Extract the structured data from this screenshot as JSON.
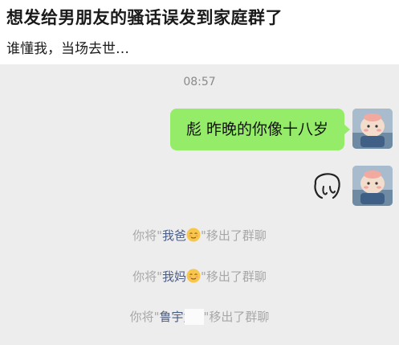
{
  "post": {
    "title": "想发给男朋友的骚话误发到家庭群了",
    "subtitle": "谁懂我，当场去世…"
  },
  "chat": {
    "timestamp": "08:57",
    "message": "彪 昨晚的你像十八岁",
    "system_messages": [
      {
        "prefix": "你将\"",
        "name": "我爸",
        "emoji": "relieved-face-icon",
        "suffix": "\"移出了群聊"
      },
      {
        "prefix": "你将\"",
        "name": "我妈",
        "emoji": "relieved-face-icon",
        "suffix": "\"移出了群聊"
      },
      {
        "prefix": "你将\"",
        "name": "鲁宇竟",
        "suffix": "\"移出了群聊"
      }
    ]
  },
  "colors": {
    "bubble": "#95ec69",
    "chat_background": "#ededed",
    "system_text": "#a7a7a7",
    "name_link": "#4a5d86"
  }
}
